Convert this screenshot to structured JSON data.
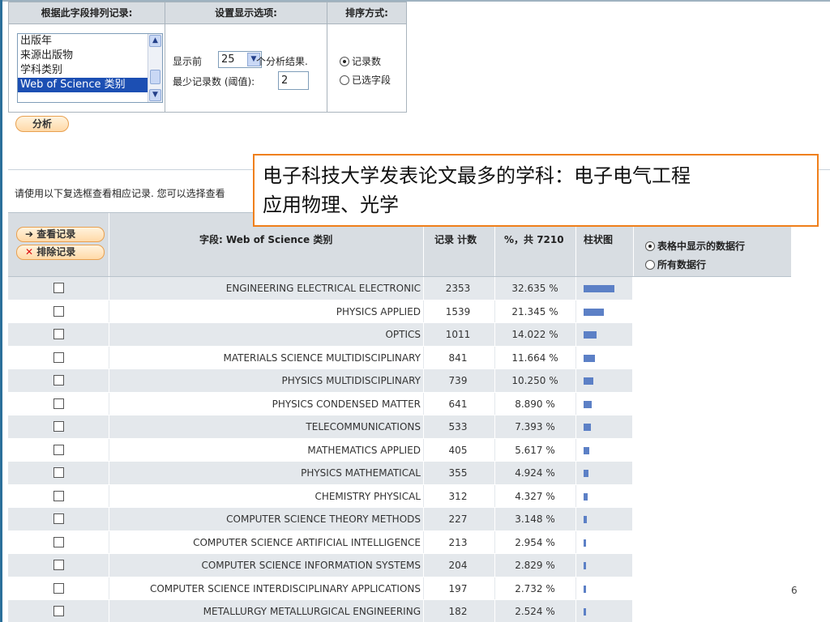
{
  "settings": {
    "col1_header": "根据此字段排列记录:",
    "col2_header": "设置显示选项:",
    "col3_header": "排序方式:",
    "field_options": [
      "出版年",
      "来源出版物",
      "学科类别",
      "Web of Science 类别"
    ],
    "display_prefix": "显示前",
    "display_count": "25",
    "display_suffix": "个分析结果.",
    "min_label": "最少记录数 (阈值):",
    "min_value": "2",
    "sort_by_count": "记录数",
    "sort_by_field": "已选字段"
  },
  "analyze_label": "分析",
  "instruction": "请使用以下复选框查看相应记录. 您可以选择查看",
  "callout": {
    "line1": "电子科技大学发表论文最多的学科：电子电气工程",
    "line2": "应用物理、光学"
  },
  "table": {
    "view_records": "查看记录",
    "exclude_records": "排除记录",
    "field_header": "字段: Web of Science 类别",
    "count_header": "记录 计数",
    "pct_header": "%，共 7210",
    "chart_header": "柱状图",
    "show_table_rows": "表格中显示的数据行",
    "show_all_rows": "所有数据行",
    "rows": [
      {
        "field": "ENGINEERING ELECTRICAL ELECTRONIC",
        "count": "2353",
        "pct": "32.635 %",
        "value": 32.635
      },
      {
        "field": "PHYSICS APPLIED",
        "count": "1539",
        "pct": "21.345 %",
        "value": 21.345
      },
      {
        "field": "OPTICS",
        "count": "1011",
        "pct": "14.022 %",
        "value": 14.022
      },
      {
        "field": "MATERIALS SCIENCE MULTIDISCIPLINARY",
        "count": "841",
        "pct": "11.664 %",
        "value": 11.664
      },
      {
        "field": "PHYSICS MULTIDISCIPLINARY",
        "count": "739",
        "pct": "10.250 %",
        "value": 10.25
      },
      {
        "field": "PHYSICS CONDENSED MATTER",
        "count": "641",
        "pct": "8.890 %",
        "value": 8.89
      },
      {
        "field": "TELECOMMUNICATIONS",
        "count": "533",
        "pct": "7.393 %",
        "value": 7.393
      },
      {
        "field": "MATHEMATICS APPLIED",
        "count": "405",
        "pct": "5.617 %",
        "value": 5.617
      },
      {
        "field": "PHYSICS MATHEMATICAL",
        "count": "355",
        "pct": "4.924 %",
        "value": 4.924
      },
      {
        "field": "CHEMISTRY PHYSICAL",
        "count": "312",
        "pct": "4.327 %",
        "value": 4.327
      },
      {
        "field": "COMPUTER SCIENCE THEORY METHODS",
        "count": "227",
        "pct": "3.148 %",
        "value": 3.148
      },
      {
        "field": "COMPUTER SCIENCE ARTIFICIAL INTELLIGENCE",
        "count": "213",
        "pct": "2.954 %",
        "value": 2.954
      },
      {
        "field": "COMPUTER SCIENCE INFORMATION SYSTEMS",
        "count": "204",
        "pct": "2.829 %",
        "value": 2.829
      },
      {
        "field": "COMPUTER SCIENCE INTERDISCIPLINARY APPLICATIONS",
        "count": "197",
        "pct": "2.732 %",
        "value": 2.732
      },
      {
        "field": "METALLURGY METALLURGICAL ENGINEERING",
        "count": "182",
        "pct": "2.524 %",
        "value": 2.524
      }
    ]
  },
  "page_number": "6",
  "colors": {
    "accent": "#ef7f1a",
    "bar": "#5c80c6",
    "header": "#d8dde2",
    "selection": "#1c4fb3"
  }
}
